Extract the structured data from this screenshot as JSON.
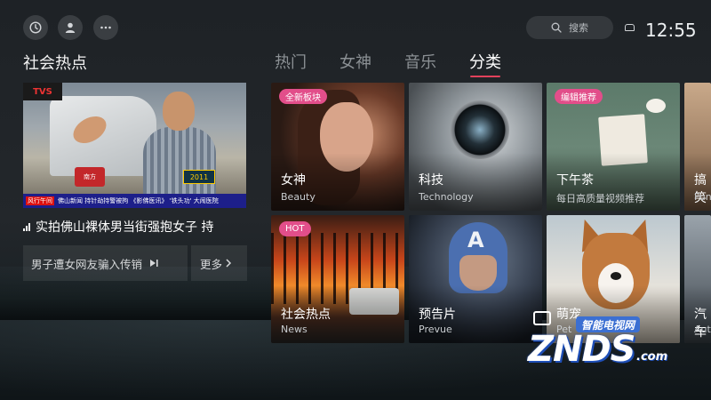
{
  "topbar": {
    "icons": [
      "clock-icon",
      "user-icon",
      "more-icon"
    ],
    "search_label": "搜索",
    "time": "12:55"
  },
  "section_title": "社会热点",
  "tabs": [
    {
      "label": "热门",
      "active": false
    },
    {
      "label": "女神",
      "active": false
    },
    {
      "label": "音乐",
      "active": false
    },
    {
      "label": "分类",
      "active": true
    }
  ],
  "video": {
    "channel_logo": "TVS",
    "badge": "2011",
    "mic_text": "南方",
    "ticker_tag": "风行午间",
    "ticker_text": "佛山新闻 持针劫持警被拘  《影佛医讯》 '铁头功' 大闹医院",
    "headline": "实拍佛山裸体男当街强抱女子 持"
  },
  "related": {
    "item_label": "男子遭女网友骗入传销",
    "more_label": "更多"
  },
  "cards": [
    {
      "key": "beauty",
      "title": "女神",
      "subtitle": "Beauty",
      "tag": "全新板块",
      "tag_color": "#e24e8a"
    },
    {
      "key": "tech",
      "title": "科技",
      "subtitle": "Technology",
      "tag": "",
      "tag_color": ""
    },
    {
      "key": "tea",
      "title": "下午茶",
      "subtitle": "每日高质量视频推荐",
      "tag": "编辑推荐",
      "tag_color": "#e24e8a"
    },
    {
      "key": "funny",
      "title": "搞笑",
      "subtitle": "Funny",
      "tag": "",
      "tag_color": ""
    },
    {
      "key": "news",
      "title": "社会热点",
      "subtitle": "News",
      "tag": "HOT",
      "tag_color": "#e24e8a"
    },
    {
      "key": "trailer",
      "title": "预告片",
      "subtitle": "Prevue",
      "tag": "",
      "tag_color": ""
    },
    {
      "key": "pet",
      "title": "萌宠",
      "subtitle": "Pet",
      "tag": "",
      "tag_color": ""
    },
    {
      "key": "car",
      "title": "汽车",
      "subtitle": "Auto",
      "tag": "",
      "tag_color": ""
    }
  ],
  "watermark": {
    "sub": "智能电视网",
    "main": "ZNDS",
    "suffix": ".com"
  },
  "colors": {
    "accent": "#e2415b",
    "tag_pink": "#e24e8a",
    "background": "#23272b"
  }
}
